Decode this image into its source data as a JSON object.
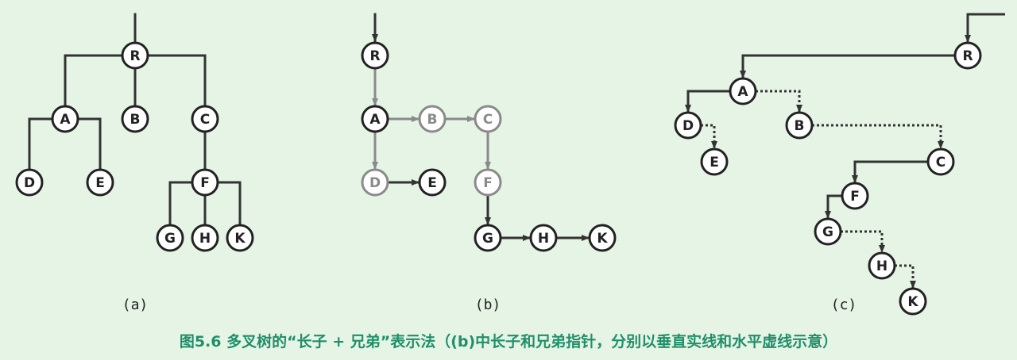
{
  "colors": {
    "background": "#e6f4e6",
    "edge": "#333333",
    "node_stroke": "#222222",
    "node_fill": "#ffffff",
    "faded": "#8a8a8a",
    "caption": "#1f8f6a"
  },
  "diagram": {
    "panels": [
      {
        "label": "(a)",
        "nodes": [
          {
            "id": "R",
            "label": "R"
          },
          {
            "id": "A",
            "label": "A"
          },
          {
            "id": "B",
            "label": "B"
          },
          {
            "id": "C",
            "label": "C"
          },
          {
            "id": "D",
            "label": "D"
          },
          {
            "id": "E",
            "label": "E"
          },
          {
            "id": "F",
            "label": "F"
          },
          {
            "id": "G",
            "label": "G"
          },
          {
            "id": "H",
            "label": "H"
          },
          {
            "id": "K",
            "label": "K"
          }
        ],
        "edges": [
          {
            "from": "R",
            "to": "A",
            "style": "solid"
          },
          {
            "from": "R",
            "to": "B",
            "style": "solid"
          },
          {
            "from": "R",
            "to": "C",
            "style": "solid"
          },
          {
            "from": "A",
            "to": "D",
            "style": "solid"
          },
          {
            "from": "A",
            "to": "E",
            "style": "solid"
          },
          {
            "from": "C",
            "to": "F",
            "style": "solid"
          },
          {
            "from": "F",
            "to": "G",
            "style": "solid"
          },
          {
            "from": "F",
            "to": "H",
            "style": "solid"
          },
          {
            "from": "F",
            "to": "K",
            "style": "solid"
          }
        ]
      },
      {
        "label": "(b)",
        "nodes": [
          {
            "id": "R",
            "label": "R"
          },
          {
            "id": "A",
            "label": "A"
          },
          {
            "id": "B",
            "label": "B"
          },
          {
            "id": "C",
            "label": "C"
          },
          {
            "id": "D",
            "label": "D"
          },
          {
            "id": "E",
            "label": "E"
          },
          {
            "id": "F",
            "label": "F"
          },
          {
            "id": "G",
            "label": "G"
          },
          {
            "id": "H",
            "label": "H"
          },
          {
            "id": "K",
            "label": "K"
          }
        ],
        "edges": [
          {
            "from": "R",
            "to": "A",
            "style": "first-child"
          },
          {
            "from": "A",
            "to": "B",
            "style": "next-sibling"
          },
          {
            "from": "B",
            "to": "C",
            "style": "next-sibling"
          },
          {
            "from": "A",
            "to": "D",
            "style": "first-child"
          },
          {
            "from": "D",
            "to": "E",
            "style": "next-sibling"
          },
          {
            "from": "C",
            "to": "F",
            "style": "first-child"
          },
          {
            "from": "F",
            "to": "G",
            "style": "first-child"
          },
          {
            "from": "G",
            "to": "H",
            "style": "next-sibling"
          },
          {
            "from": "H",
            "to": "K",
            "style": "next-sibling"
          }
        ]
      },
      {
        "label": "(c)",
        "nodes": [
          {
            "id": "R",
            "label": "R"
          },
          {
            "id": "A",
            "label": "A"
          },
          {
            "id": "D",
            "label": "D"
          },
          {
            "id": "E",
            "label": "E"
          },
          {
            "id": "B",
            "label": "B"
          },
          {
            "id": "C",
            "label": "C"
          },
          {
            "id": "F",
            "label": "F"
          },
          {
            "id": "G",
            "label": "G"
          },
          {
            "id": "H",
            "label": "H"
          },
          {
            "id": "K",
            "label": "K"
          }
        ],
        "edges": [
          {
            "from": "R",
            "to": "A",
            "style": "first-child"
          },
          {
            "from": "A",
            "to": "D",
            "style": "first-child"
          },
          {
            "from": "A",
            "to": "B",
            "style": "next-sibling"
          },
          {
            "from": "D",
            "to": "E",
            "style": "next-sibling"
          },
          {
            "from": "B",
            "to": "C",
            "style": "next-sibling"
          },
          {
            "from": "C",
            "to": "F",
            "style": "first-child"
          },
          {
            "from": "F",
            "to": "G",
            "style": "first-child"
          },
          {
            "from": "G",
            "to": "H",
            "style": "next-sibling"
          },
          {
            "from": "H",
            "to": "K",
            "style": "next-sibling"
          }
        ]
      }
    ],
    "caption": "图5.6 多叉树的“长子 + 兄弟”表示法（(b)中长子和兄弟指针，分别以垂直实线和水平虚线示意）"
  }
}
